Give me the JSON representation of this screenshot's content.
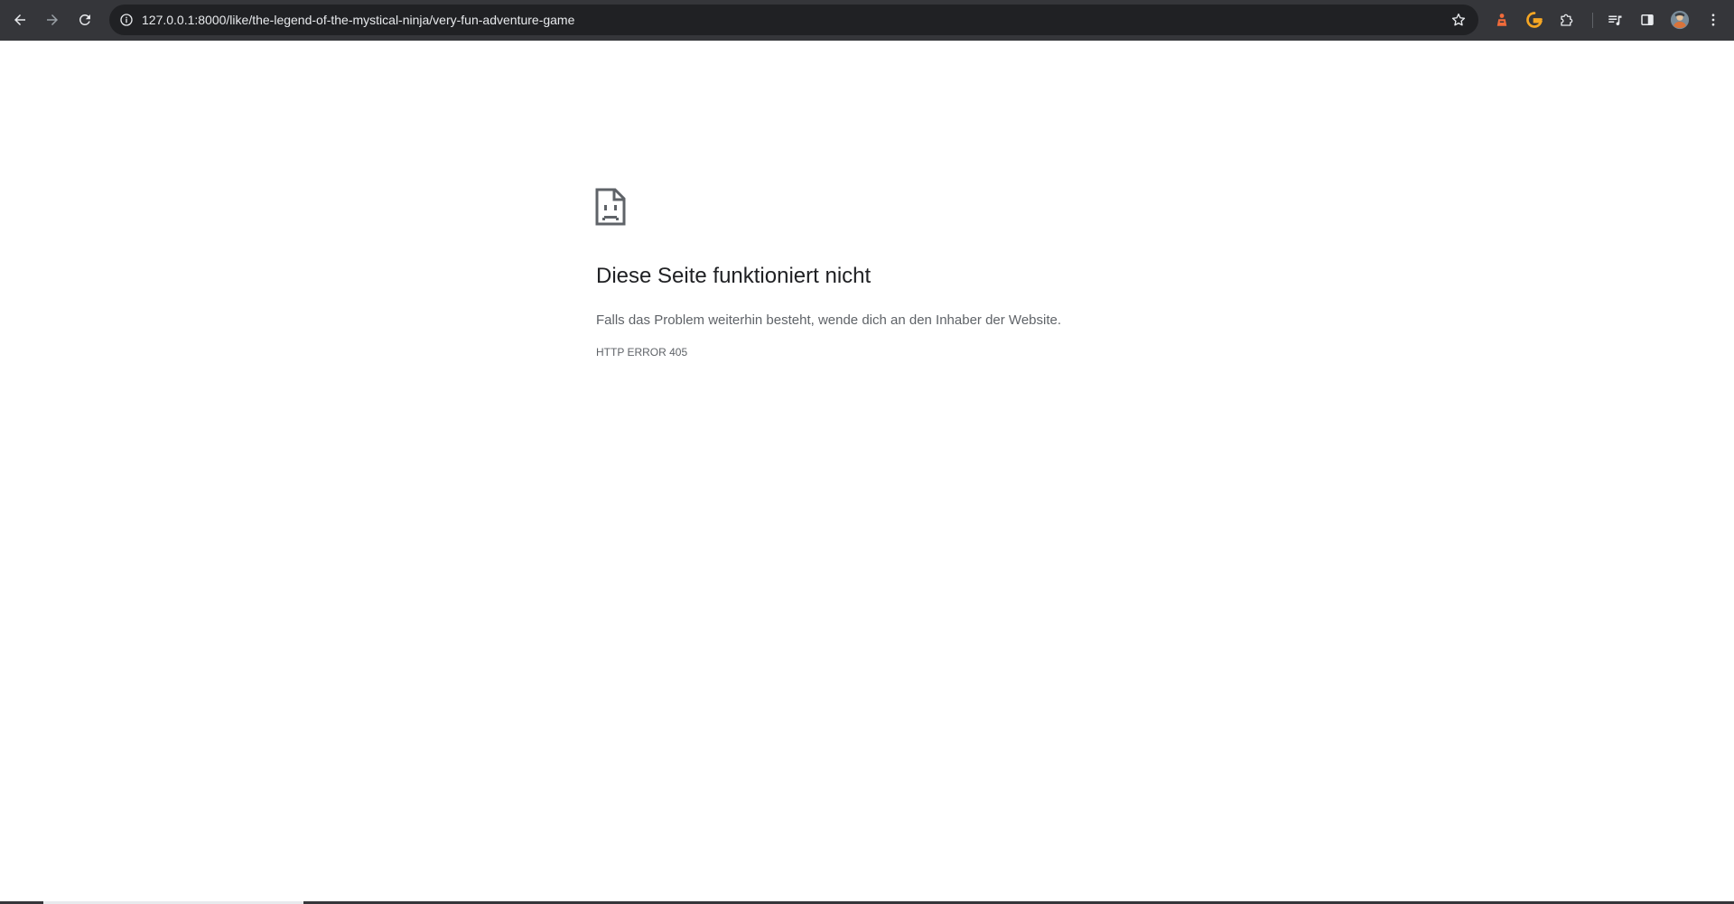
{
  "browser": {
    "url": "127.0.0.1:8000/like/the-legend-of-the-mystical-ninja/very-fun-adventure-game",
    "toolbar_color": "#35363a",
    "omnibox_color": "#202124",
    "icons": {
      "back": "arrow-left-icon",
      "forward": "arrow-right-icon",
      "reload": "reload-icon",
      "site_info": "info-circle-icon",
      "bookmark": "star-icon",
      "extension_1": "orange-extension-icon",
      "extension_2": "grammarly-g-icon",
      "extensions": "puzzle-icon",
      "media": "media-queue-icon",
      "side_panel": "side-panel-icon",
      "profile": "avatar-icon",
      "menu": "kebab-menu-icon"
    }
  },
  "error_page": {
    "icon": "sad-document-icon",
    "title": "Diese Seite funktioniert nicht",
    "description": "Falls das Problem weiterhin besteht, wende dich an den Inhaber der Website.",
    "error_code": "HTTP ERROR 405"
  }
}
